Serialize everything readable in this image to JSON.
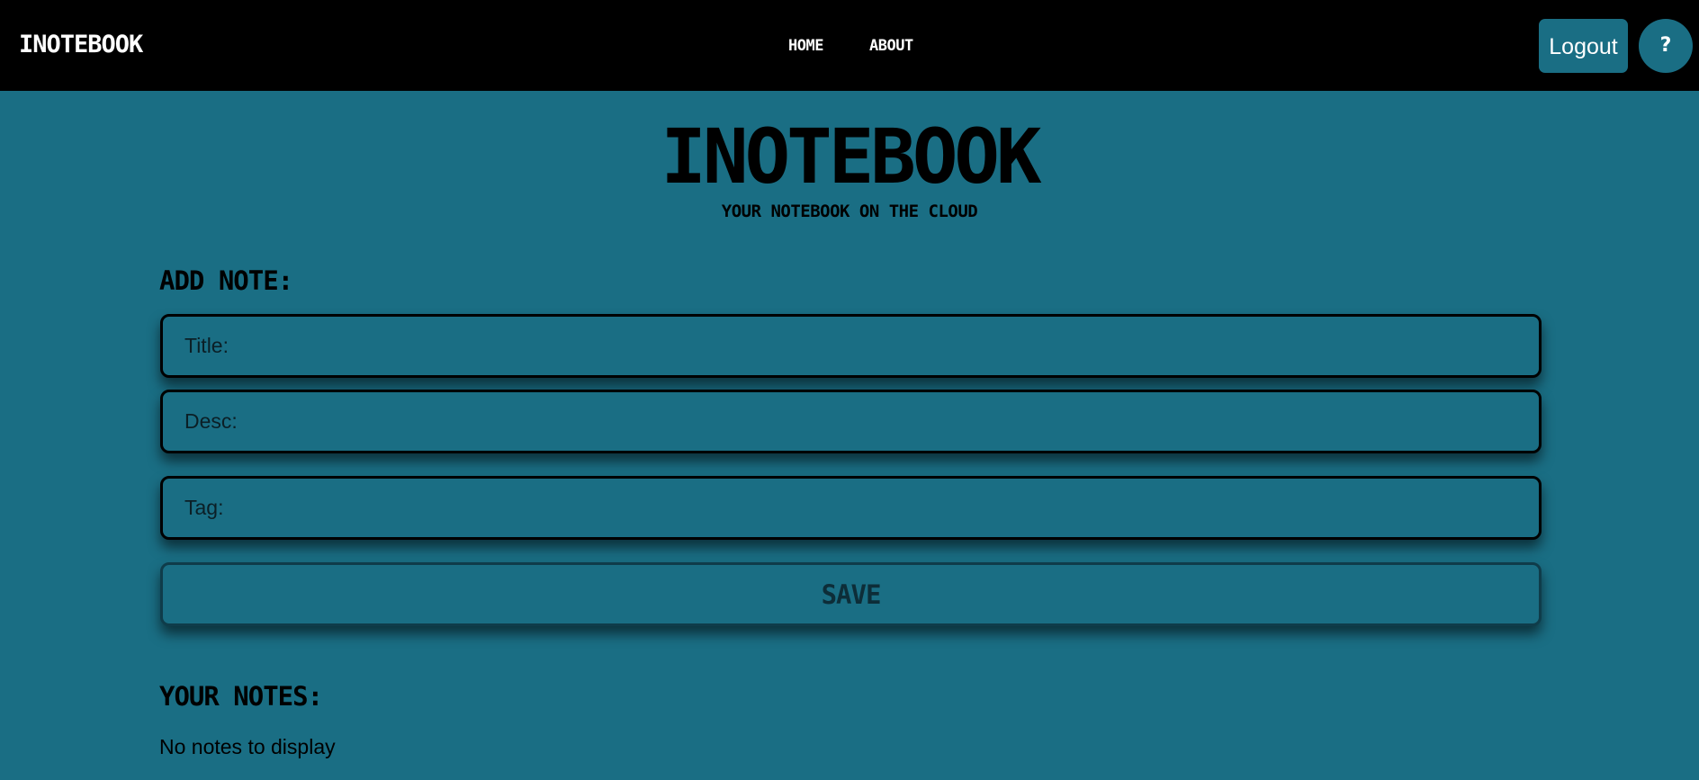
{
  "navbar": {
    "brand": "INOTEBOOK",
    "links": [
      "HOME",
      "ABOUT"
    ],
    "logout_label": "Logout",
    "help_label": "?"
  },
  "hero": {
    "title": "INOTEBOOK",
    "subtitle": "YOUR NOTEBOOK ON THE CLOUD"
  },
  "add_note": {
    "heading": "ADD NOTE:",
    "title_placeholder": "Title:",
    "title_value": "",
    "desc_placeholder": "Desc:",
    "desc_value": "",
    "tag_placeholder": "Tag:",
    "tag_value": "",
    "save_label": "SAVE"
  },
  "notes": {
    "heading": "YOUR NOTES:",
    "empty_message": "No notes to display"
  },
  "colors": {
    "background": "#1a6e84",
    "navbar": "#000000",
    "accent": "#1a6e84",
    "text": "#000000"
  },
  "icons": {
    "help": "question-mark-icon"
  }
}
